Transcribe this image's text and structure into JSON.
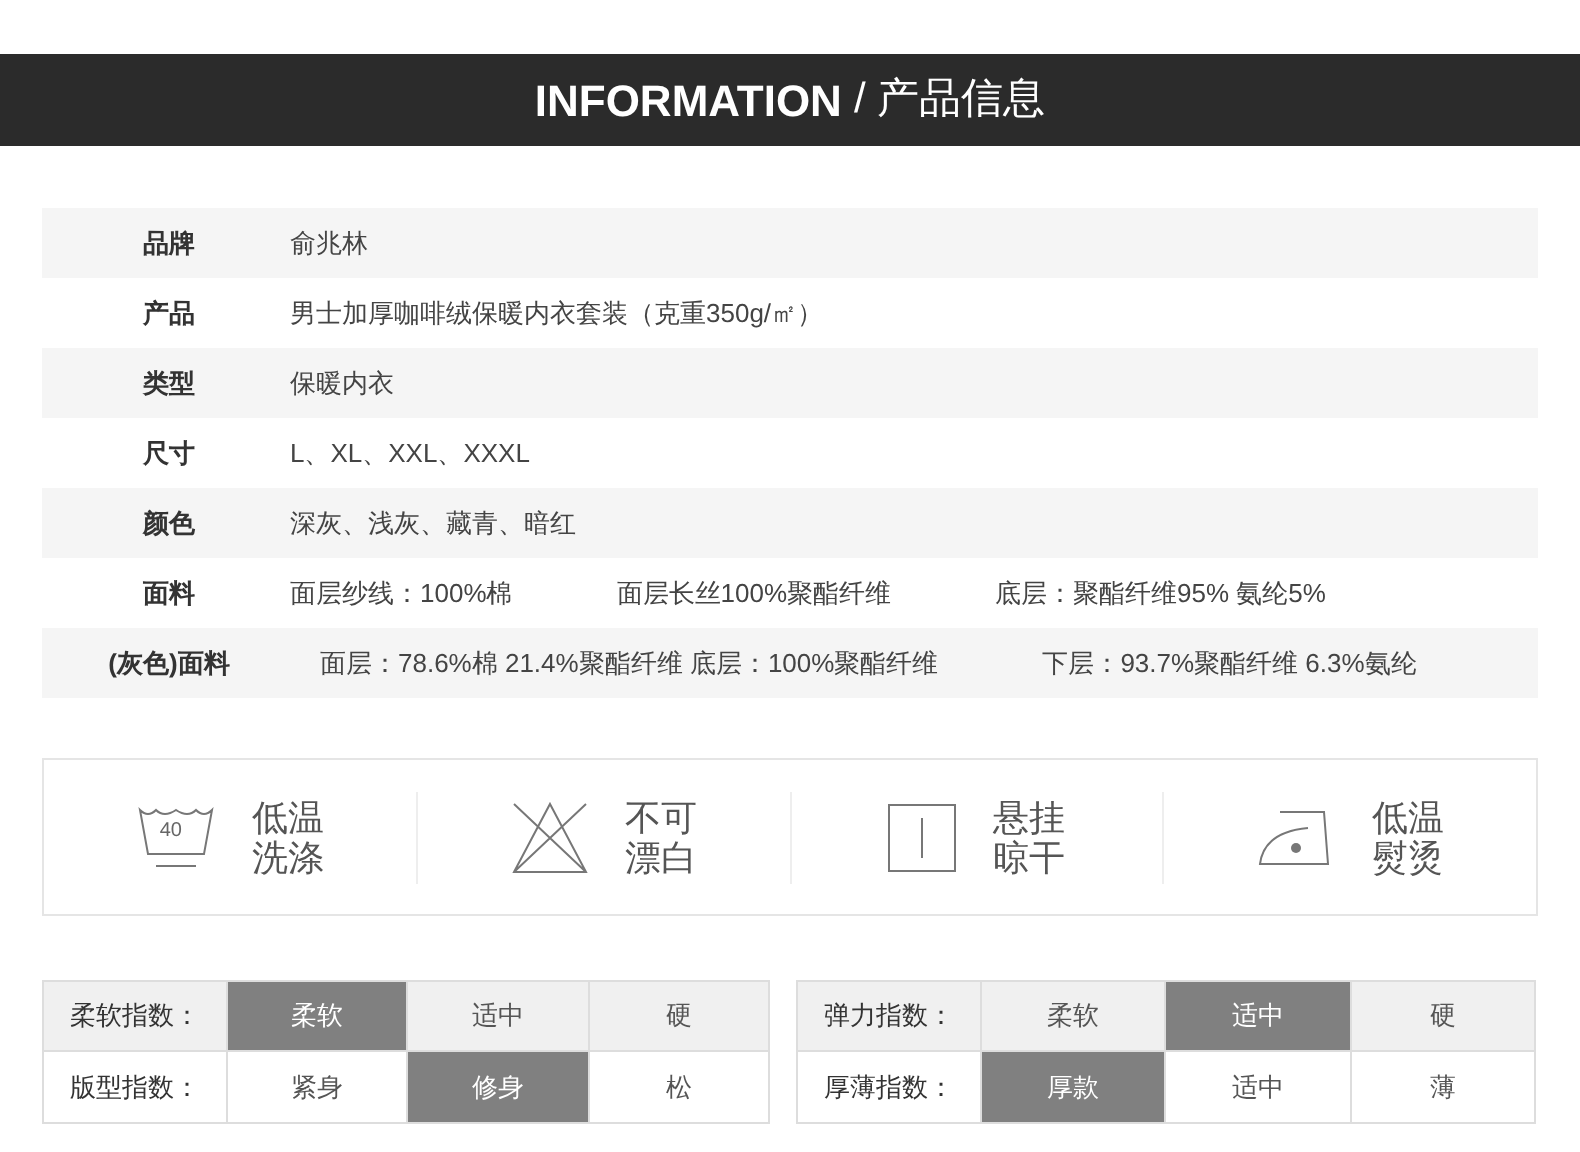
{
  "header": {
    "title": "INFORMATION",
    "subtitle": "/ 产品信息"
  },
  "specs": [
    {
      "label": "品牌",
      "values": [
        "俞兆林"
      ]
    },
    {
      "label": "产品",
      "values": [
        "男士加厚咖啡绒保暖内衣套装（克重350g/㎡）"
      ]
    },
    {
      "label": "类型",
      "values": [
        "保暖内衣"
      ]
    },
    {
      "label": "尺寸",
      "values": [
        "L、XL、XXL、XXXL"
      ]
    },
    {
      "label": "颜色",
      "values": [
        "深灰、浅灰、藏青、暗红"
      ]
    },
    {
      "label": "面料",
      "values": [
        "面层纱线：100%棉",
        "面层长丝100%聚酯纤维",
        "底层：聚酯纤维95% 氨纶5%"
      ]
    },
    {
      "label": "(灰色)面料",
      "values": [
        "面层：78.6%棉 21.4%聚酯纤维 底层：100%聚酯纤维",
        "下层：93.7%聚酯纤维 6.3%氨纶"
      ]
    }
  ],
  "care": [
    {
      "kind": "wash",
      "temp": "40",
      "lines": [
        "低温",
        "洗涤"
      ]
    },
    {
      "kind": "no-bleach",
      "lines": [
        "不可",
        "漂白"
      ]
    },
    {
      "kind": "hang-dry",
      "lines": [
        "悬挂",
        "晾干"
      ]
    },
    {
      "kind": "iron",
      "lines": [
        "低温",
        "熨烫"
      ]
    }
  ],
  "indices": [
    {
      "rows": [
        {
          "label": "柔软指数：",
          "options": [
            {
              "text": "柔软",
              "selected": true
            },
            {
              "text": "适中",
              "selected": false
            },
            {
              "text": "硬",
              "selected": false
            }
          ]
        },
        {
          "label": "版型指数：",
          "options": [
            {
              "text": "紧身",
              "selected": false
            },
            {
              "text": "修身",
              "selected": true
            },
            {
              "text": "松",
              "selected": false
            }
          ]
        }
      ]
    },
    {
      "rows": [
        {
          "label": "弹力指数：",
          "options": [
            {
              "text": "柔软",
              "selected": false
            },
            {
              "text": "适中",
              "selected": true
            },
            {
              "text": "硬",
              "selected": false
            }
          ]
        },
        {
          "label": "厚薄指数：",
          "options": [
            {
              "text": "厚款",
              "selected": true
            },
            {
              "text": "适中",
              "selected": false
            },
            {
              "text": "薄",
              "selected": false
            }
          ]
        }
      ]
    }
  ]
}
